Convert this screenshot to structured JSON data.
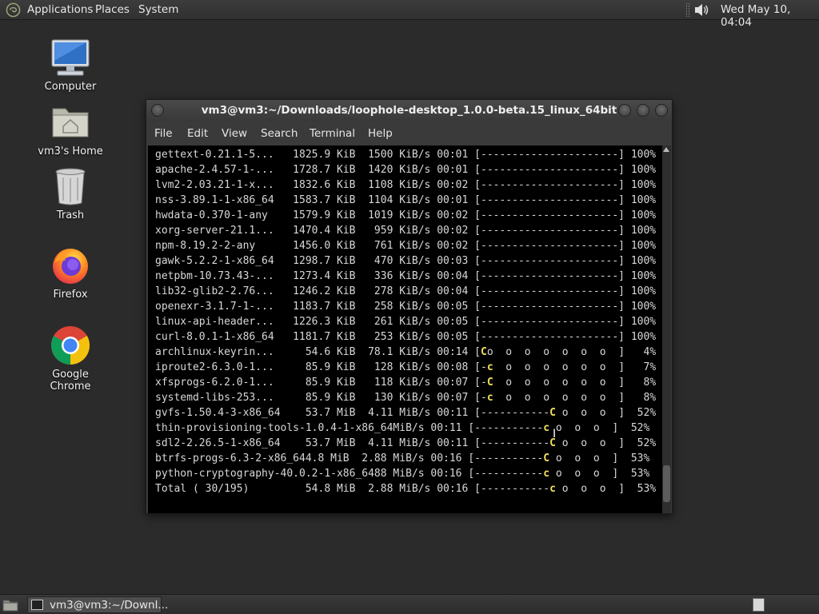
{
  "top_panel": {
    "menus": [
      "Applications",
      "Places",
      "System"
    ],
    "clock": "Wed May 10, 04:04"
  },
  "desktop_icons": [
    {
      "label": "Computer",
      "icon": "computer-icon"
    },
    {
      "label": "vm3's Home",
      "icon": "home-folder-icon"
    },
    {
      "label": "Trash",
      "icon": "trash-icon"
    },
    {
      "label": "Firefox",
      "icon": "firefox-icon"
    },
    {
      "label": "Google Chrome",
      "icon": "chrome-icon"
    }
  ],
  "terminal": {
    "title": "vm3@vm3:~/Downloads/loophole-desktop_1.0.0-beta.15_linux_64bit",
    "menu": [
      "File",
      "Edit",
      "View",
      "Search",
      "Terminal",
      "Help"
    ],
    "lines": [
      {
        "pre": "gettext-0.21.1-5...   1825.9 KiB  1500 KiB/s 00:01 [----------------------] 100%"
      },
      {
        "pre": "apache-2.4.57-1-...   1728.7 KiB  1420 KiB/s 00:01 [----------------------] 100%"
      },
      {
        "pre": "lvm2-2.03.21-1-x...   1832.6 KiB  1108 KiB/s 00:02 [----------------------] 100%"
      },
      {
        "pre": "nss-3.89.1-1-x86_64   1583.7 KiB  1104 KiB/s 00:01 [----------------------] 100%"
      },
      {
        "pre": "hwdata-0.370-1-any    1579.9 KiB  1019 KiB/s 00:02 [----------------------] 100%"
      },
      {
        "pre": "xorg-server-21.1...   1470.4 KiB   959 KiB/s 00:02 [----------------------] 100%"
      },
      {
        "pre": "npm-8.19.2-2-any      1456.0 KiB   761 KiB/s 00:02 [----------------------] 100%"
      },
      {
        "pre": "gawk-5.2.2-1-x86_64   1298.7 KiB   470 KiB/s 00:03 [----------------------] 100%"
      },
      {
        "pre": "netpbm-10.73.43-...   1273.4 KiB   336 KiB/s 00:04 [----------------------] 100%"
      },
      {
        "pre": "lib32-glib2-2.76...   1246.2 KiB   278 KiB/s 00:04 [----------------------] 100%"
      },
      {
        "pre": "openexr-3.1.7-1-...   1183.7 KiB   258 KiB/s 00:05 [----------------------] 100%"
      },
      {
        "pre": "linux-api-header...   1226.3 KiB   261 KiB/s 00:05 [----------------------] 100%"
      },
      {
        "pre": "curl-8.0.1-1-x86_64   1181.7 KiB   253 KiB/s 00:05 [----------------------] 100%"
      },
      {
        "pre": "archlinux-keyrin...     54.6 KiB  78.1 KiB/s 00:14 [",
        "pac": "C",
        "post": "o  o  o  o  o  o  o  ]   4%"
      },
      {
        "pre": "iproute2-6.3.0-1...     85.9 KiB   128 KiB/s 00:08 [-",
        "pac": "c",
        "post": "  o  o  o  o  o  o  ]   7%"
      },
      {
        "pre": "xfsprogs-6.2.0-1...     85.9 KiB   118 KiB/s 00:07 [-",
        "pac": "C",
        "post": "  o  o  o  o  o  o  ]   8%"
      },
      {
        "pre": "systemd-libs-253...     85.9 KiB   130 KiB/s 00:07 [-",
        "pac": "c",
        "post": "  o  o  o  o  o  o  ]   8%"
      },
      {
        "pre": "gvfs-1.50.4-3-x86_64    53.7 MiB  4.11 MiB/s 00:11 [-----------",
        "pac": "C",
        "post": " o  o  o  ]  52%"
      },
      {
        "pre": "thin-provisioning-tools-1.0.4-1-x86_64MiB/s 00:11 [-----------",
        "pac": "c",
        "post": " o  o  o  ]  52%"
      },
      {
        "pre": "sdl2-2.26.5-1-x86_64    53.7 MiB  4.11 MiB/s 00:11 [-----------",
        "pac": "C",
        "post": " o  o  o  ]  52%"
      },
      {
        "pre": "btrfs-progs-6.3-2-x86_644.8 MiB  2.88 MiB/s 00:16 [-----------",
        "pac": "C",
        "post": " o  o  o  ]  53%"
      },
      {
        "pre": "python-cryptography-40.0.2-1-x86_6488 MiB/s 00:16 [-----------",
        "pac": "c",
        "post": " o  o  o  ]  53%"
      },
      {
        "pre": "Total ( 30/195)         54.8 MiB  2.88 MiB/s 00:16 [-----------",
        "pac": "c",
        "post": " o  o  o  ]  53%"
      }
    ]
  },
  "taskbar": {
    "task_label": "vm3@vm3:~/Downl..."
  },
  "colors": {
    "desktop_bg": "#2b2b2b",
    "terminal_bg": "#000000",
    "pacman_yellow": "#f0e05a"
  }
}
